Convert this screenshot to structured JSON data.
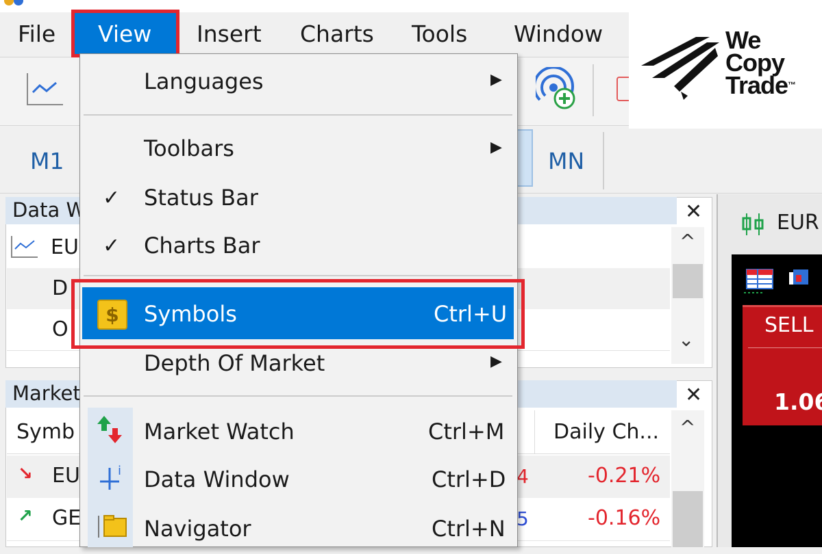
{
  "menubar": {
    "items": [
      "File",
      "View",
      "Insert",
      "Charts",
      "Tools",
      "Window"
    ],
    "active": "View"
  },
  "timeframes": {
    "m1": "M1",
    "mn": "MN"
  },
  "brand": {
    "line1": "We",
    "line2": "Copy",
    "line3": "Trade",
    "tm": "™"
  },
  "data_window": {
    "title": "Data W",
    "rows": [
      {
        "label": "EU"
      },
      {
        "label": "D"
      },
      {
        "label": "O"
      }
    ]
  },
  "market_watch": {
    "title": "Market",
    "columns": {
      "symbol": "Symb",
      "daily_change": "Daily Ch..."
    },
    "rows": [
      {
        "symbol": "EU",
        "tail_digit": "4",
        "change": "-0.21%",
        "direction": "down"
      },
      {
        "symbol": "GE",
        "tail_digit": "5",
        "change": "-0.16%",
        "direction": "up"
      }
    ]
  },
  "chart": {
    "tab_title": "EUR",
    "sell_label": "SELL",
    "sell_price": "1.06"
  },
  "view_menu": {
    "items": [
      {
        "label": "Languages",
        "submenu": true
      },
      {
        "label": "Toolbars",
        "submenu": true
      },
      {
        "label": "Status Bar",
        "checked": true
      },
      {
        "label": "Charts Bar",
        "checked": true
      },
      {
        "label": "Symbols",
        "shortcut": "Ctrl+U",
        "highlighted": true
      },
      {
        "label": "Depth Of Market",
        "submenu": true
      },
      {
        "label": "Market Watch",
        "shortcut": "Ctrl+M"
      },
      {
        "label": "Data Window",
        "shortcut": "Ctrl+D"
      },
      {
        "label": "Navigator",
        "shortcut": "Ctrl+N"
      }
    ]
  },
  "glyphs": {
    "submenu_arrow": "▶",
    "check": "✓",
    "close": "✕",
    "scroll_up": "^",
    "scroll_down": "⌄",
    "dollar": "$",
    "down_arrow": "↘",
    "up_arrow": "↗"
  },
  "colors": {
    "accent": "#0078d7",
    "highlight_frame": "#e3262e",
    "sell": "#c0141a",
    "negative": "#e3262e"
  }
}
